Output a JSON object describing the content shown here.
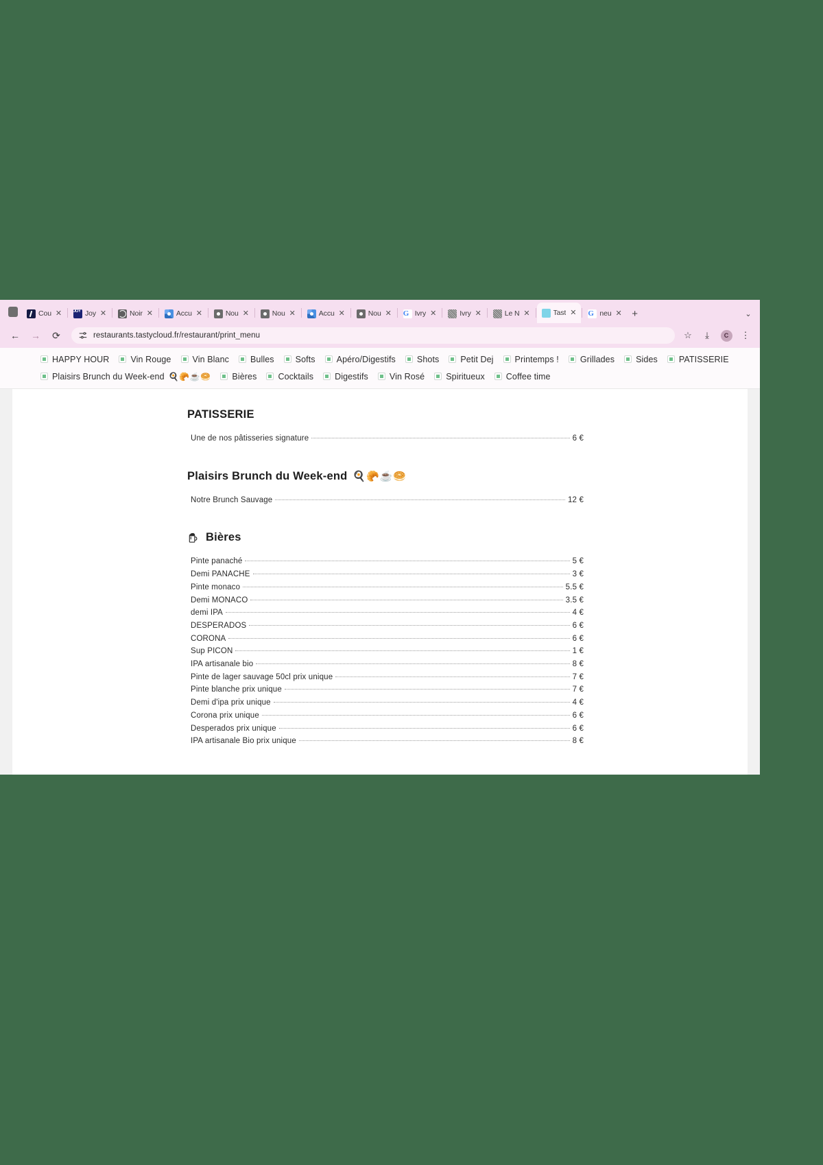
{
  "browser": {
    "tabs": [
      {
        "title": "Cou",
        "favicon": "dark-doc-icon",
        "active": false
      },
      {
        "title": "Joy",
        "favicon": "joy-app-icon",
        "active": false
      },
      {
        "title": "Noir",
        "favicon": "globe-icon",
        "active": false
      },
      {
        "title": "Accu",
        "favicon": "blue-chrome-icon",
        "active": false
      },
      {
        "title": "Nou",
        "favicon": "gray-chrome-icon",
        "active": false
      },
      {
        "title": "Nou",
        "favicon": "gray-chrome-icon",
        "active": false
      },
      {
        "title": "Accu",
        "favicon": "blue-chrome-icon",
        "active": false
      },
      {
        "title": "Nou",
        "favicon": "gray-chrome-icon",
        "active": false
      },
      {
        "title": "Ivry",
        "favicon": "google-g-icon",
        "active": false
      },
      {
        "title": "Ivry",
        "favicon": "noise-thumb-icon",
        "active": false
      },
      {
        "title": "Le N",
        "favicon": "noise-thumb-icon",
        "active": false
      },
      {
        "title": "Tast",
        "favicon": "tastycloud-icon",
        "active": true
      },
      {
        "title": "neu",
        "favicon": "google-g-icon",
        "active": false
      }
    ],
    "new_tab_label": "+",
    "tab_list_chevron": "⌄",
    "close_glyph": "✕",
    "toolbar": {
      "back_label": "←",
      "forward_label": "→",
      "reload_label": "⟳",
      "url": "restaurants.tastycloud.fr/restaurant/print_menu",
      "bookmark_star": "☆",
      "download_label": "⤓",
      "profile_initial": "C",
      "menu_label": "⋮"
    },
    "bookmarks": {
      "row1": [
        {
          "label": "HAPPY HOUR"
        },
        {
          "label": "Vin Rouge"
        },
        {
          "label": "Vin Blanc"
        },
        {
          "label": "Bulles"
        },
        {
          "label": "Softs"
        },
        {
          "label": "Apéro/Digestifs"
        },
        {
          "label": "Shots"
        },
        {
          "label": "Petit Dej"
        },
        {
          "label": "Printemps !"
        },
        {
          "label": "Grillades"
        },
        {
          "label": "Sides"
        },
        {
          "label": "PATISSERIE"
        }
      ],
      "row2": [
        {
          "label": "Plaisirs Brunch du Week-end",
          "emoji": "🍳🥐☕🥯"
        },
        {
          "label": "Bières"
        },
        {
          "label": "Cocktails"
        },
        {
          "label": "Digestifs"
        },
        {
          "label": "Vin Rosé"
        },
        {
          "label": "Spiritueux"
        },
        {
          "label": "Coffee time"
        }
      ]
    }
  },
  "menu": {
    "sections": [
      {
        "title": "PATISSERIE",
        "emoji": "",
        "icon": "",
        "items": [
          {
            "name": "Une de nos pâtisseries signature",
            "price": "6 €"
          }
        ]
      },
      {
        "title": "Plaisirs Brunch du Week-end",
        "emoji": "🍳🥐☕🥯",
        "icon": "",
        "items": [
          {
            "name": "Notre Brunch Sauvage",
            "price": "12 €"
          }
        ]
      },
      {
        "title": "Bières",
        "emoji": "",
        "icon": "beer-mug-icon",
        "items": [
          {
            "name": "Pinte panaché",
            "price": "5 €"
          },
          {
            "name": "Demi PANACHE",
            "price": "3 €"
          },
          {
            "name": "Pinte monaco",
            "price": "5.5 €"
          },
          {
            "name": "Demi MONACO",
            "price": "3.5 €"
          },
          {
            "name": "demi IPA",
            "price": "4 €"
          },
          {
            "name": "DESPERADOS",
            "price": "6 €"
          },
          {
            "name": "CORONA",
            "price": "6 €"
          },
          {
            "name": "Sup PICON",
            "price": "1 €"
          },
          {
            "name": "IPA artisanale bio",
            "price": "8 €"
          },
          {
            "name": "Pinte de lager sauvage 50cl prix unique",
            "price": "7 €"
          },
          {
            "name": "Pinte blanche prix unique",
            "price": "7 €"
          },
          {
            "name": "Demi d'ipa prix unique",
            "price": "4 €"
          },
          {
            "name": "Corona prix unique",
            "price": "6 €"
          },
          {
            "name": "Desperados prix unique",
            "price": "6 €"
          },
          {
            "name": "IPA artisanale Bio prix unique",
            "price": "8 €"
          }
        ]
      }
    ]
  },
  "colors": {
    "desktop_background": "#3e6b4a",
    "tabstrip_pink": "#f6dff0",
    "bookmark_green": "#6ec08a",
    "page_background": "#ffffff"
  }
}
